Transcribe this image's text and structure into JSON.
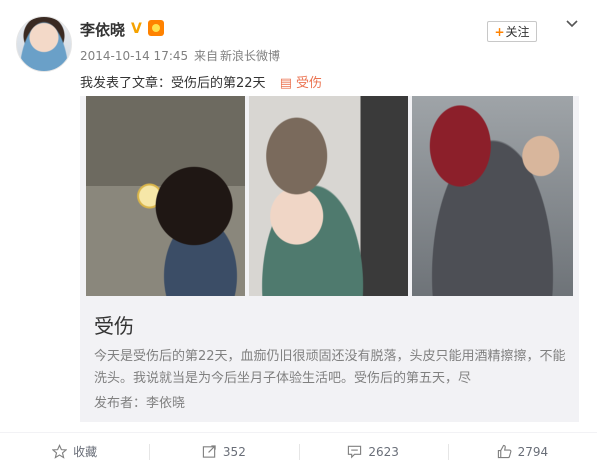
{
  "post": {
    "author": "李依晓",
    "verified_mark": "V",
    "timestamp": "2014-10-14 17:45",
    "source_prefix": "来自",
    "source": "新浪长微博",
    "text": "我发表了文章：受伤后的第22天",
    "article_link": "受伤"
  },
  "follow_button": {
    "plus": "+",
    "label": "关注"
  },
  "card": {
    "title": "受伤",
    "summary": "今天是受伤后的第22天，血痂仍旧很顽固还没有脱落，头皮只能用酒精擦擦，不能洗头。我说就当是为今后坐月子体验生活吧。受伤后的第五天，尽",
    "author_label": "发布者：李依晓"
  },
  "actions": {
    "favorite": {
      "label": "收藏",
      "icon": "star-icon"
    },
    "repost": {
      "count": "352",
      "icon": "share-icon"
    },
    "comment": {
      "count": "2623",
      "icon": "comment-icon"
    },
    "like": {
      "count": "2794",
      "icon": "thumb-up-icon"
    }
  },
  "colors": {
    "accent": "#ff8200",
    "link": "#eb7350",
    "meta": "#808080"
  }
}
